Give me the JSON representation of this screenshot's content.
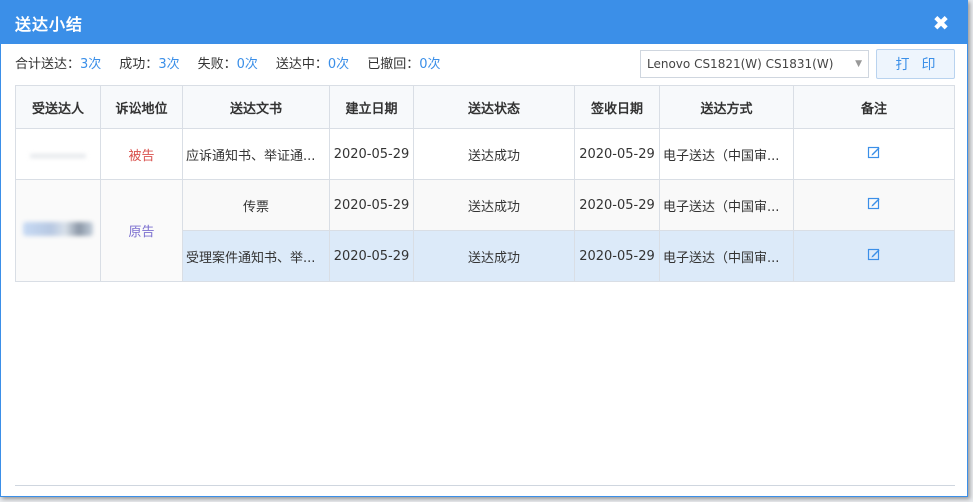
{
  "dialog": {
    "title": "送达小结",
    "close_glyph": "✖"
  },
  "stats": [
    {
      "label": "合计送达：",
      "value": "3次"
    },
    {
      "label": "成功：",
      "value": "3次"
    },
    {
      "label": "失败：",
      "value": "0次"
    },
    {
      "label": "送达中：",
      "value": "0次"
    },
    {
      "label": "已撤回：",
      "value": "0次"
    }
  ],
  "printer": {
    "selected": "Lenovo CS1821(W) CS1831(W)",
    "caret": "▼"
  },
  "print_button": "打印",
  "table": {
    "headers": [
      "受送达人",
      "诉讼地位",
      "送达文书",
      "建立日期",
      "送达状态",
      "签收日期",
      "送达方式",
      "备注"
    ],
    "groups": [
      {
        "role": "被告",
        "rows": [
          {
            "doc": "应诉通知书、举证通...",
            "created": "2020-05-29",
            "status": "送达成功",
            "signed": "2020-05-29",
            "method": "电子送达（中国审..."
          }
        ]
      },
      {
        "role": "原告",
        "rows": [
          {
            "doc": "传票",
            "created": "2020-05-29",
            "status": "送达成功",
            "signed": "2020-05-29",
            "method": "电子送达（中国审..."
          },
          {
            "doc": "受理案件通知书、举...",
            "created": "2020-05-29",
            "status": "送达成功",
            "signed": "2020-05-29",
            "method": "电子送达（中国审..."
          }
        ]
      }
    ]
  },
  "colors": {
    "accent": "#3b8fe8",
    "defendant": "#d9534f",
    "plaintiff": "#7b6fcf",
    "selected_row": "#dceaf9"
  },
  "icons": {
    "edit": "edit-icon"
  }
}
